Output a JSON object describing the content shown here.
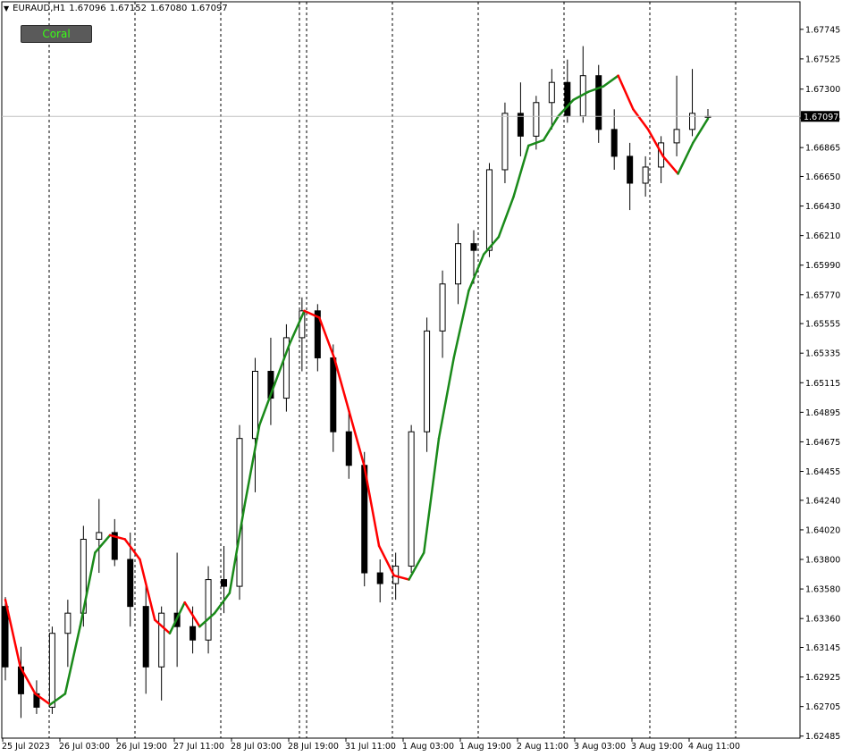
{
  "header": {
    "symbol_tf": "EURAUD,H1",
    "open": "1.67096",
    "high": "1.67152",
    "low": "1.67080",
    "close": "1.67097"
  },
  "indicator_button": {
    "label": "Coral"
  },
  "colors": {
    "background": "#ffffff",
    "candles": "#000000",
    "coral_up": "#1a8a1a",
    "coral_down": "#ff0000",
    "grid_vertical": "#000000",
    "current_price_line": "#c0c0c0",
    "price_badge_bg": "#000000",
    "price_badge_text": "#ffffff",
    "coral_button_text": "#39ff14"
  },
  "chart_data": {
    "type": "candlestick",
    "title": "EURAUD,H1",
    "ylim": [
      1.6247,
      1.6795
    ],
    "y_ticks": [
      "1.67745",
      "1.67525",
      "1.67300",
      "1.67085",
      "1.66865",
      "1.66650",
      "1.66430",
      "1.66210",
      "1.65990",
      "1.65770",
      "1.65555",
      "1.65335",
      "1.65115",
      "1.64895",
      "1.64675",
      "1.64455",
      "1.64240",
      "1.64020",
      "1.63800",
      "1.63580",
      "1.63360",
      "1.63145",
      "1.62925",
      "1.62705",
      "1.62485"
    ],
    "x_ticks": [
      "25 Jul 2023",
      "26 Jul 03:00",
      "26 Jul 19:00",
      "27 Jul 11:00",
      "28 Jul 03:00",
      "28 Jul 19:00",
      "31 Jul 11:00",
      "1 Aug 03:00",
      "1 Aug 19:00",
      "2 Aug 11:00",
      "3 Aug 03:00",
      "3 Aug 19:00",
      "4 Aug 11:00"
    ],
    "current_price": "1.67097",
    "grid": "vertical dashed separators only",
    "series": [
      {
        "name": "Coral",
        "indicator": true,
        "values": [
          1.635,
          1.63,
          1.628,
          1.6272,
          1.628,
          1.633,
          1.6385,
          1.6398,
          1.6395,
          1.638,
          1.6335,
          1.6325,
          1.6348,
          1.633,
          1.634,
          1.6355,
          1.642,
          1.648,
          1.651,
          1.654,
          1.6565,
          1.656,
          1.653,
          1.649,
          1.645,
          1.639,
          1.6368,
          1.6365,
          1.6385,
          1.647,
          1.653,
          1.658,
          1.6607,
          1.662,
          1.665,
          1.6688,
          1.6692,
          1.671,
          1.6722,
          1.6728,
          1.6732,
          1.674,
          1.6715,
          1.67,
          1.668,
          1.6667,
          1.669,
          1.6708
        ]
      },
      {
        "name": "EURAUD,H1",
        "ohlc_sampled": [
          [
            1.6345,
            1.6352,
            1.629,
            1.63
          ],
          [
            1.63,
            1.6315,
            1.6262,
            1.628
          ],
          [
            1.628,
            1.629,
            1.6265,
            1.627
          ],
          [
            1.627,
            1.633,
            1.6265,
            1.6325
          ],
          [
            1.6325,
            1.635,
            1.63,
            1.634
          ],
          [
            1.634,
            1.6405,
            1.633,
            1.6395
          ],
          [
            1.6395,
            1.6425,
            1.637,
            1.64
          ],
          [
            1.64,
            1.641,
            1.6375,
            1.638
          ],
          [
            1.638,
            1.64,
            1.633,
            1.6345
          ],
          [
            1.6345,
            1.636,
            1.628,
            1.63
          ],
          [
            1.63,
            1.6345,
            1.6275,
            1.634
          ],
          [
            1.634,
            1.6385,
            1.63,
            1.633
          ],
          [
            1.633,
            1.6345,
            1.631,
            1.632
          ],
          [
            1.632,
            1.6375,
            1.631,
            1.6365
          ],
          [
            1.6365,
            1.639,
            1.634,
            1.636
          ],
          [
            1.636,
            1.648,
            1.635,
            1.647
          ],
          [
            1.647,
            1.653,
            1.643,
            1.652
          ],
          [
            1.652,
            1.6545,
            1.648,
            1.65
          ],
          [
            1.65,
            1.6555,
            1.649,
            1.6545
          ],
          [
            1.6545,
            1.6575,
            1.652,
            1.6565
          ],
          [
            1.6565,
            1.657,
            1.652,
            1.653
          ],
          [
            1.653,
            1.654,
            1.646,
            1.6475
          ],
          [
            1.6475,
            1.649,
            1.644,
            1.645
          ],
          [
            1.645,
            1.646,
            1.636,
            1.637
          ],
          [
            1.637,
            1.638,
            1.6348,
            1.6362
          ],
          [
            1.6362,
            1.6385,
            1.635,
            1.6375
          ],
          [
            1.6375,
            1.648,
            1.637,
            1.6475
          ],
          [
            1.6475,
            1.656,
            1.646,
            1.655
          ],
          [
            1.655,
            1.6595,
            1.653,
            1.6585
          ],
          [
            1.6585,
            1.663,
            1.657,
            1.6615
          ],
          [
            1.6615,
            1.6625,
            1.6585,
            1.661
          ],
          [
            1.661,
            1.6675,
            1.6605,
            1.667
          ],
          [
            1.667,
            1.672,
            1.666,
            1.6712
          ],
          [
            1.6712,
            1.6735,
            1.668,
            1.6695
          ],
          [
            1.6695,
            1.6725,
            1.6685,
            1.672
          ],
          [
            1.672,
            1.6745,
            1.67,
            1.6735
          ],
          [
            1.6735,
            1.6752,
            1.6705,
            1.671
          ],
          [
            1.671,
            1.6762,
            1.6705,
            1.674
          ],
          [
            1.674,
            1.6748,
            1.669,
            1.67
          ],
          [
            1.67,
            1.6715,
            1.667,
            1.668
          ],
          [
            1.668,
            1.669,
            1.664,
            1.666
          ],
          [
            1.666,
            1.668,
            1.665,
            1.6672
          ],
          [
            1.6672,
            1.6695,
            1.666,
            1.669
          ],
          [
            1.669,
            1.674,
            1.668,
            1.67
          ],
          [
            1.67,
            1.6745,
            1.6695,
            1.6712
          ],
          [
            1.67096,
            1.67152,
            1.6708,
            1.67097
          ]
        ]
      }
    ]
  }
}
